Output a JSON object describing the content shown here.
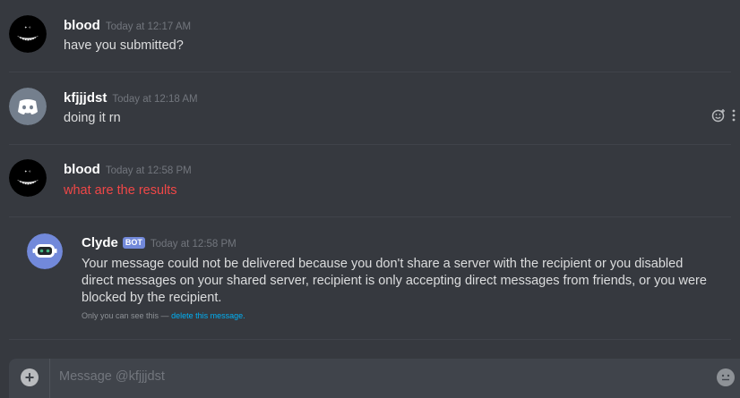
{
  "messages": [
    {
      "username": "blood",
      "timestamp": "Today at 12:17 AM",
      "content": "have you submitted?"
    },
    {
      "username": "kfjjjdst",
      "timestamp": "Today at 12:18 AM",
      "content": "doing it rn"
    },
    {
      "username": "blood",
      "timestamp": "Today at 12:58 PM",
      "content": "what are the results"
    }
  ],
  "clyde": {
    "username": "Clyde",
    "bot_tag": "BOT",
    "timestamp": "Today at 12:58 PM",
    "content": "Your message could not be delivered because you don't share a server with the recipient or you disabled direct messages on your shared server, recipient is only accepting direct messages from friends, or you were blocked by the recipient.",
    "note_prefix": "Only you can see this —",
    "note_link": "delete this message."
  },
  "composer": {
    "placeholder": "Message @kfjjjdst"
  },
  "colors": {
    "background": "#36393f",
    "error_red": "#f04747",
    "link_blue": "#00b0f4",
    "blurple": "#7289da"
  }
}
